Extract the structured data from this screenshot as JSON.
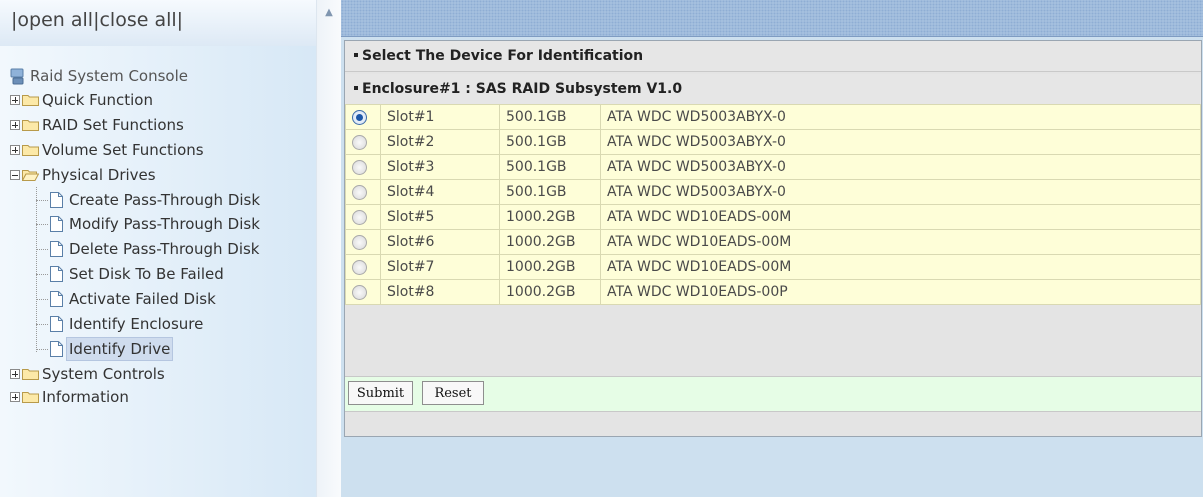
{
  "tree": {
    "open_all": "open all",
    "close_all": "close all",
    "root": "Raid System Console",
    "nodes": [
      {
        "label": "Quick Function",
        "expanded": false
      },
      {
        "label": "RAID Set Functions",
        "expanded": false
      },
      {
        "label": "Volume Set Functions",
        "expanded": false
      },
      {
        "label": "Physical Drives",
        "expanded": true
      },
      {
        "label": "System Controls",
        "expanded": false
      },
      {
        "label": "Information",
        "expanded": false
      }
    ],
    "physical_drive_items": [
      "Create Pass-Through Disk",
      "Modify Pass-Through Disk",
      "Delete Pass-Through Disk",
      "Set Disk To Be Failed",
      "Activate Failed Disk",
      "Identify Enclosure",
      "Identify Drive"
    ],
    "selected_item": "Identify Drive"
  },
  "main": {
    "section_title": "Select The Device For Identification",
    "enclosure_title": "Enclosure#1 : SAS RAID Subsystem V1.0",
    "selected_slot": "Slot#1",
    "slots": [
      {
        "slot": "Slot#1",
        "capacity": "500.1GB",
        "model": "ATA WDC WD5003ABYX-0"
      },
      {
        "slot": "Slot#2",
        "capacity": "500.1GB",
        "model": "ATA WDC WD5003ABYX-0"
      },
      {
        "slot": "Slot#3",
        "capacity": "500.1GB",
        "model": "ATA WDC WD5003ABYX-0"
      },
      {
        "slot": "Slot#4",
        "capacity": "500.1GB",
        "model": "ATA WDC WD5003ABYX-0"
      },
      {
        "slot": "Slot#5",
        "capacity": "1000.2GB",
        "model": "ATA WDC WD10EADS-00M"
      },
      {
        "slot": "Slot#6",
        "capacity": "1000.2GB",
        "model": "ATA WDC WD10EADS-00M"
      },
      {
        "slot": "Slot#7",
        "capacity": "1000.2GB",
        "model": "ATA WDC WD10EADS-00M"
      },
      {
        "slot": "Slot#8",
        "capacity": "1000.2GB",
        "model": "ATA WDC WD10EADS-00P"
      }
    ],
    "submit_label": "Submit",
    "reset_label": "Reset"
  },
  "colors": {
    "row_background": "#fefed8",
    "button_row_background": "#e6fde6",
    "selected_tree_item": "#cfdcee"
  },
  "icons": {
    "root": "raid-console-icon",
    "node": "folder-icon",
    "leaf": "document-icon",
    "expand": "plus-box-icon",
    "collapse": "minus-box-icon"
  }
}
